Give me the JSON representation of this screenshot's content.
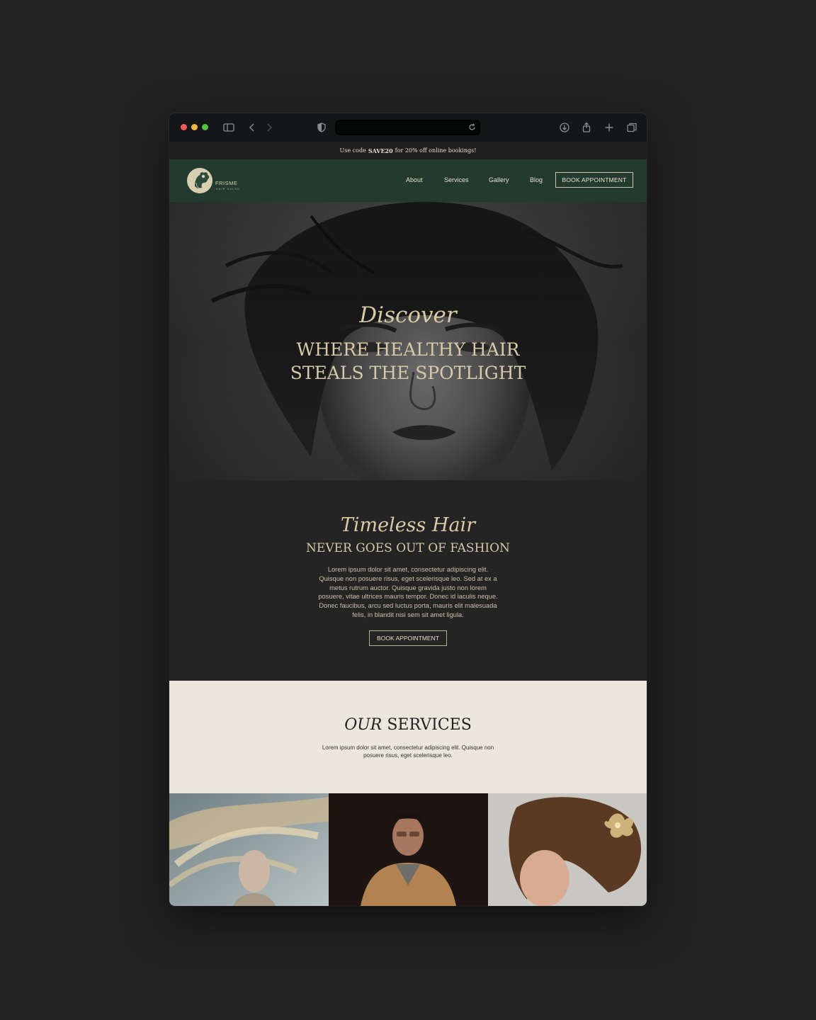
{
  "promo": {
    "prefix": "Use code",
    "code": "SAVE20",
    "suffix": "for 20% off online bookings!"
  },
  "brand": {
    "name": "FRISME",
    "tagline": "HAIR SALON"
  },
  "nav": {
    "links": [
      "About",
      "Services",
      "Gallery",
      "Blog"
    ],
    "cta": "BOOK APPOINTMENT"
  },
  "hero": {
    "script": "Discover",
    "title_line1": "WHERE HEALTHY HAIR",
    "title_line2": "STEALS THE SPOTLIGHT"
  },
  "intro": {
    "script": "Timeless Hair",
    "title": "NEVER GOES OUT OF FASHION",
    "body": "Lorem ipsum dolor sit amet, consectetur adipiscing elit. Quisque non posuere risus, eget scelerisque leo. Sed at ex a metus rutrum auctor. Quisque gravida justo non lorem posuere, vitae ultrices mauris tempor. Donec id iaculis neque. Donec faucibus, arcu sed luctus porta, mauris elit malesuada felis, in blandit nisi sem sit amet ligula.",
    "cta": "BOOK APPOINTMENT"
  },
  "services": {
    "title_italic": "OUR",
    "title_rest": "SERVICES",
    "body": "Lorem ipsum dolor sit amet, consectetur adipiscing elit. Quisque non posuere risus, eget scelerisque leo."
  },
  "colors": {
    "nav_bg": "#233a2f",
    "accent_gold": "#d5caa7",
    "services_bg": "#ebe7dc",
    "page_bg": "#232323"
  }
}
